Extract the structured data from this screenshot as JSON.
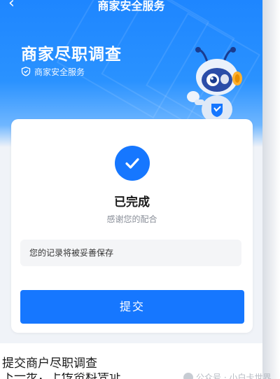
{
  "nav": {
    "back_icon": "chevron-left-icon",
    "title": "商家安全服务"
  },
  "hero": {
    "title": "商家尽职调查",
    "subtitle": "商家安全服务",
    "subtitle_icon": "shield-icon",
    "mascot": "robot-ant-mascot"
  },
  "card": {
    "status_icon": "check-icon",
    "status_title": "已完成",
    "status_subtitle": "感谢您的配合",
    "note": "您的记录将被妥善保存",
    "submit_label": "提交"
  },
  "article": {
    "caption": "提交商户尽职调查",
    "caption_next": "下一步，上传资料凭证",
    "watermark": "公众号 · 小白卡世界"
  },
  "colors": {
    "primary": "#1677ff",
    "hero_top": "#1e86ff",
    "page_bg": "#f0f3f8"
  }
}
